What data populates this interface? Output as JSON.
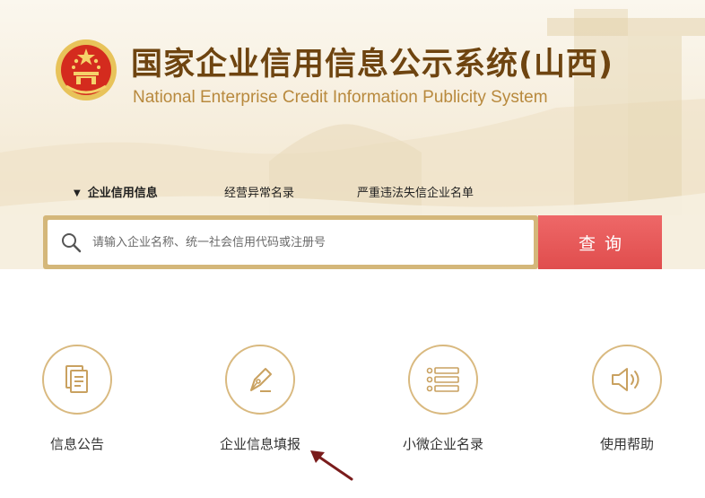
{
  "header": {
    "title": "国家企业信用信息公示系统(山西)",
    "subtitle": "National Enterprise Credit Information Publicity System"
  },
  "tabs": [
    {
      "label": "企业信用信息",
      "active": true
    },
    {
      "label": "经营异常名录",
      "active": false
    },
    {
      "label": "严重违法失信企业名单",
      "active": false
    }
  ],
  "search": {
    "placeholder": "请输入企业名称、统一社会信用代码或注册号",
    "value": "",
    "button_label": "查询"
  },
  "features": [
    {
      "label": "信息公告",
      "icon": "document-icon"
    },
    {
      "label": "企业信息填报",
      "icon": "pen-icon"
    },
    {
      "label": "小微企业名录",
      "icon": "list-icon"
    },
    {
      "label": "使用帮助",
      "icon": "speaker-icon"
    }
  ],
  "colors": {
    "title_brown": "#6e4410",
    "subtitle_gold": "#b8893d",
    "search_border": "#d4b77a",
    "search_button": "#e35353",
    "icon_gold": "#d9b97f"
  }
}
